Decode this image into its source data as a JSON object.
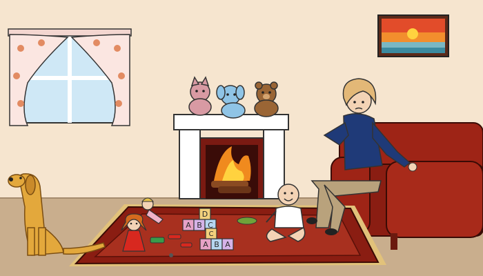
{
  "scene": {
    "colors": {
      "wall": "#f6e5cf",
      "floor": "#c9ae8d",
      "rug_outer": "#8a1d12",
      "rug_inner": "#a8301f",
      "rug_fringe": "#e2c27a",
      "sofa": "#9e2416",
      "fireplace": "#ffffff",
      "fire": "#f08a1e",
      "dog": "#e3a83c",
      "woman_top": "#1f3a78",
      "woman_pants": "#b9a27c"
    },
    "objects": [
      "window-with-curtains",
      "sunset-painting",
      "fireplace",
      "teddy-bear-toys",
      "sofa",
      "woman",
      "baby",
      "dog",
      "rug",
      "alphabet-blocks",
      "dolls"
    ],
    "blocks": [
      {
        "letter": "A",
        "color": "#e7a2c7"
      },
      {
        "letter": "B",
        "color": "#d6b3e8"
      },
      {
        "letter": "C",
        "color": "#b7d6f1"
      },
      {
        "letter": "D",
        "color": "#f2d07c"
      },
      {
        "letter": "A",
        "color": "#e7a2c7"
      },
      {
        "letter": "B",
        "color": "#b7d6f1"
      },
      {
        "letter": "A",
        "color": "#d6b3e8"
      },
      {
        "letter": "C",
        "color": "#f2d07c"
      }
    ]
  }
}
